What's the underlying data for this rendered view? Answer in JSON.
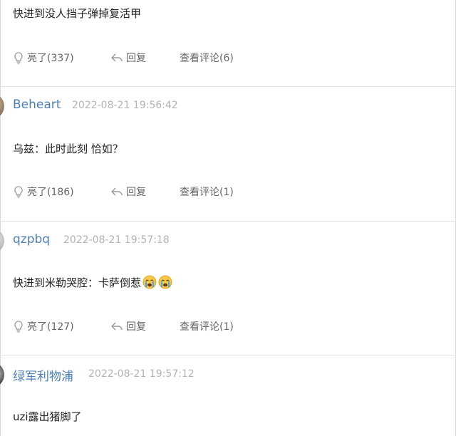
{
  "comments": [
    {
      "content": "快进到没人挡子弹掉复活甲",
      "like_label": "亮了(337)",
      "reply_label": "回复",
      "view_label": "查看评论(6)"
    },
    {
      "username": "Beheart",
      "time": "2022-08-21 19:56:42",
      "content": "乌兹：此时此刻 恰如？",
      "like_label": "亮了(186)",
      "reply_label": "回复",
      "view_label": "查看评论(1)"
    },
    {
      "username": "qzpbq",
      "time": "2022-08-21 19:57:18",
      "content": "快进到米勒哭腔：卡萨倒惹",
      "emojis": [
        "loudly-crying-face",
        "loudly-crying-face"
      ],
      "like_label": "亮了(127)",
      "reply_label": "回复",
      "view_label": "查看评论(1)"
    },
    {
      "username": "绿军利物浦",
      "time": "2022-08-21 19:57:12",
      "content": "uzi露出猪脚了"
    }
  ],
  "colors": {
    "username": "#4d7fb8",
    "timestamp": "#b3b3b3",
    "action_text": "#666666",
    "divider": "#e3e3e3"
  }
}
